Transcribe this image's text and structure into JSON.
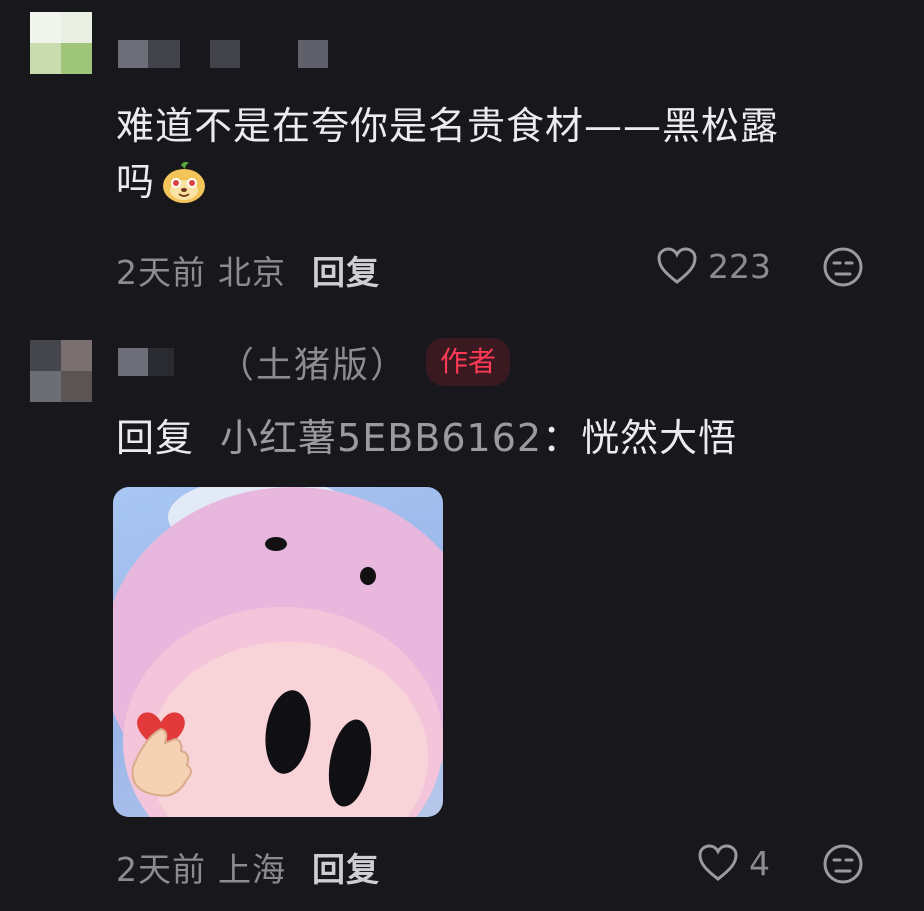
{
  "comments": [
    {
      "text_line1": "难道不是在夸你是名贵食材——黑松露",
      "text_line2": "吗",
      "time": "2天前",
      "location": "北京",
      "reply_label": "回复",
      "likes": "223",
      "emoji_icon": "cute-face-emoji-icon"
    },
    {
      "username_suffix": "（土猪版）",
      "badge": "作者",
      "reply_prefix": "回复",
      "mention": "小红薯5EBB6162",
      "colon": "：",
      "reply_text": "恍然大悟",
      "sticker_icon": "pink-pig-heart-sticker",
      "time": "2天前",
      "location": "上海",
      "reply_label": "回复",
      "likes": "4"
    }
  ],
  "colors": {
    "background": "#17171c",
    "badge_red": "#ff3a57",
    "meta_gray": "#8b8b92"
  }
}
